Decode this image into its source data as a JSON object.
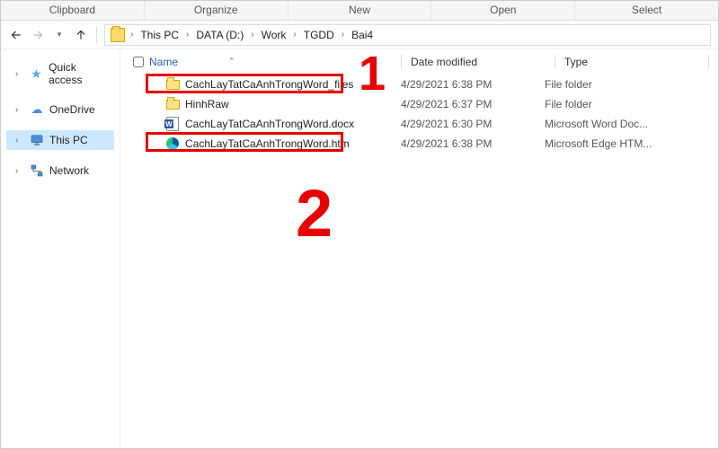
{
  "ribbon": {
    "tabs": [
      "Clipboard",
      "Organize",
      "New",
      "Open",
      "Select"
    ]
  },
  "breadcrumb": {
    "items": [
      "This PC",
      "DATA (D:)",
      "Work",
      "TGDD",
      "Bai4"
    ]
  },
  "sidebar": {
    "items": [
      {
        "label": "Quick access"
      },
      {
        "label": "OneDrive"
      },
      {
        "label": "This PC"
      },
      {
        "label": "Network"
      }
    ]
  },
  "columns": {
    "name": "Name",
    "date": "Date modified",
    "type": "Type"
  },
  "files": [
    {
      "name": "CachLayTatCaAnhTrongWord_files",
      "date": "4/29/2021 6:38 PM",
      "type": "File folder"
    },
    {
      "name": "HinhRaw",
      "date": "4/29/2021 6:37 PM",
      "type": "File folder"
    },
    {
      "name": "CachLayTatCaAnhTrongWord.docx",
      "date": "4/29/2021 6:30 PM",
      "type": "Microsoft Word Doc..."
    },
    {
      "name": "CachLayTatCaAnhTrongWord.htm",
      "date": "4/29/2021 6:38 PM",
      "type": "Microsoft Edge HTM..."
    }
  ],
  "annotations": {
    "num1": "1",
    "num2": "2"
  }
}
